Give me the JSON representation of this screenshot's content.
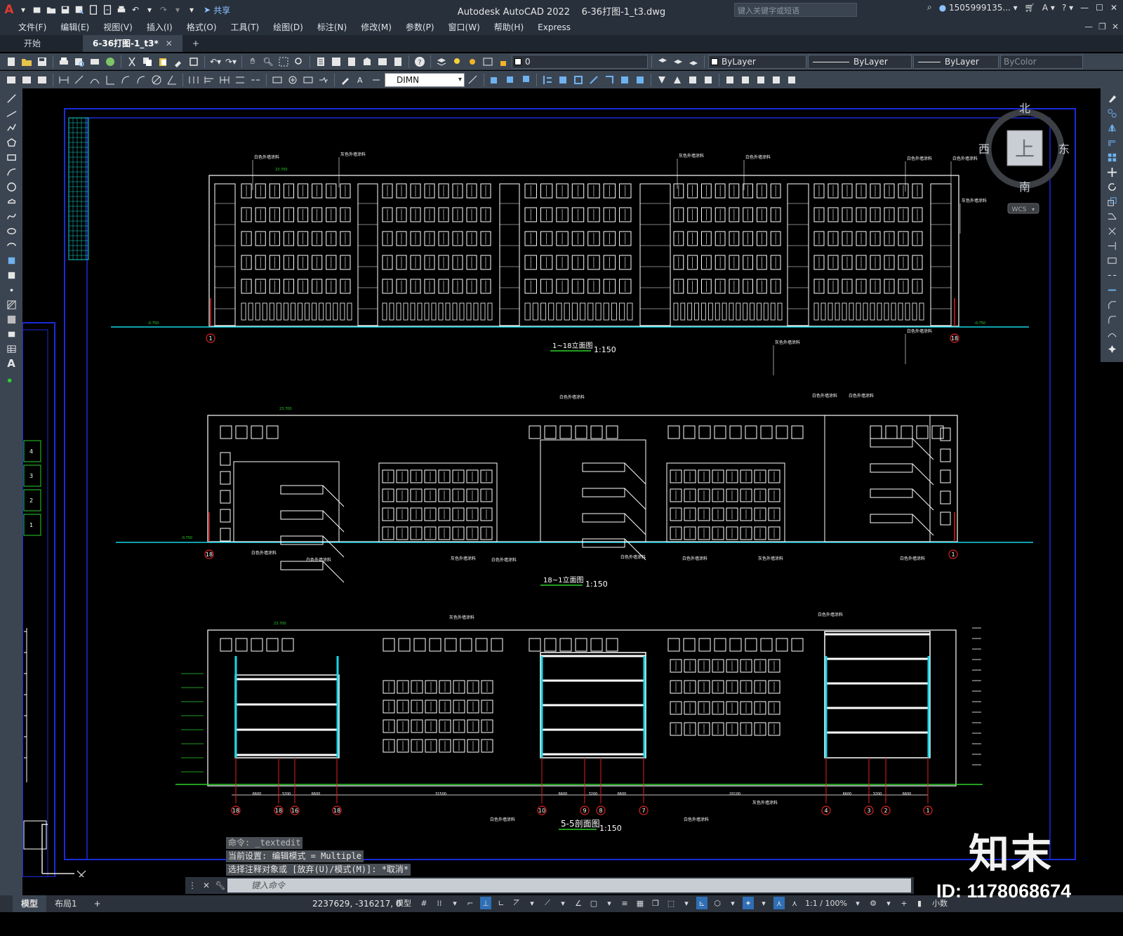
{
  "app": {
    "title": "Autodesk AutoCAD 2022",
    "file": "6-36打图-1_t3.dwg",
    "share_label": "共享",
    "search_placeholder": "键入关键字或短语",
    "user": "1505999135...",
    "logo_letter": "A"
  },
  "menu": {
    "items": [
      "文件(F)",
      "编辑(E)",
      "视图(V)",
      "插入(I)",
      "格式(O)",
      "工具(T)",
      "绘图(D)",
      "标注(N)",
      "修改(M)",
      "参数(P)",
      "窗口(W)",
      "帮助(H)",
      "Express"
    ]
  },
  "tabs": {
    "start": "开始",
    "active": "6-36打图-1_t3*",
    "close": "✕",
    "add": "+"
  },
  "toolbar": {
    "layer_value": "0",
    "color": "ByLayer",
    "linetype": "ByLayer",
    "lineweight": "ByLayer",
    "plotstyle": "ByColor",
    "dimstyle": "DIMN"
  },
  "viewcube": {
    "north": "北",
    "south": "南",
    "east": "东",
    "west": "西",
    "top": "上",
    "wcs": "WCS"
  },
  "drawing": {
    "elev1_title": "1~18立面图",
    "elev1_scale": "1:150",
    "elev2_title": "18~1立面图",
    "elev2_scale": "1:150",
    "section_title": "5-5剖面图",
    "section_scale": "1:150",
    "note_white": "白色外墙涂料",
    "note_gray": "灰色外墙涂料",
    "level_top": "23.700",
    "level_ground": "-0.750",
    "axis_labels_1": [
      "1",
      "18"
    ],
    "axis_labels_2": [
      "18",
      "1"
    ],
    "section_axes": [
      "18",
      "18",
      "16",
      "18",
      "10",
      "9",
      "8",
      "7",
      "4",
      "3",
      "2",
      "1"
    ],
    "section_dims": [
      "6600",
      "3200",
      "6600",
      "31500",
      "6600",
      "3200",
      "6600",
      "20100",
      "6600",
      "3200",
      "6600"
    ]
  },
  "command": {
    "history": [
      "命令: _textedit",
      "当前设置: 编辑模式 = Multiple",
      "选择注释对象或 [放弃(U)/模式(M)]: *取消*"
    ],
    "placeholder": "键入命令"
  },
  "status": {
    "tab_model": "模型",
    "tab_layout": "布局1",
    "add": "+",
    "coords": "2237629, -316217, 0",
    "mode": "模型",
    "scale": "1:1 / 100%",
    "units": "小数"
  },
  "watermark": {
    "brand": "知末",
    "id": "ID: 1178068674"
  },
  "colors": {
    "ui_dark": "#27303b",
    "ui_panel": "#3b4552",
    "canvas": "#000000",
    "frame_blue": "#1a2bd9",
    "ground_cyan": "#16d6e6",
    "axis_red": "#e02020",
    "drawing_white": "#ffffff",
    "accent_green": "#2ad12a"
  }
}
